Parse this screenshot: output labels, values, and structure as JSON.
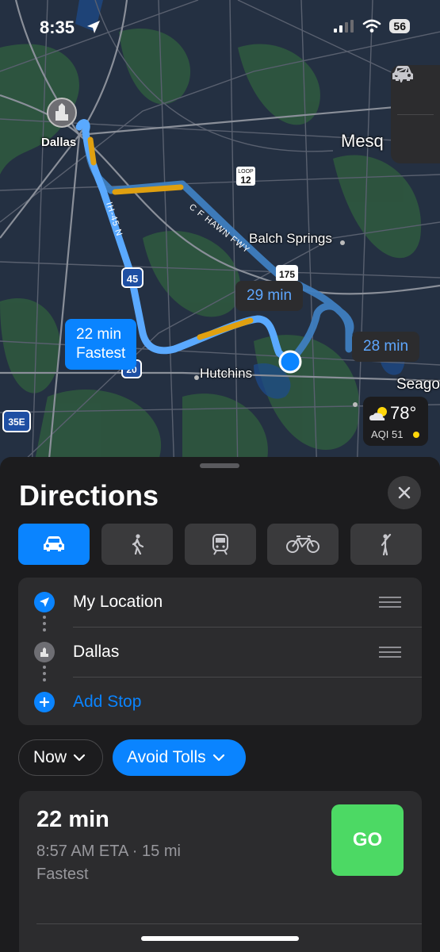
{
  "status_bar": {
    "time": "8:35",
    "battery": "56"
  },
  "map": {
    "labels": {
      "dallas": "Dallas",
      "mesq": "Mesq",
      "balch_springs": "Balch Springs",
      "hutchins": "Hutchins",
      "seago": "Seago",
      "loop_top": "LOOP",
      "loop_num": "12",
      "i45_shield": "45",
      "i20_shield": "20",
      "i35e_shield": "35E",
      "us175_shield": "175",
      "ih45n": "IH-45 N",
      "cfhawn": "C F HAWN FWY"
    },
    "routes": [
      {
        "time": "29 min"
      },
      {
        "time": "28 min"
      },
      {
        "time": "22 min",
        "tag": "Fastest",
        "selected": true
      }
    ],
    "weather": {
      "temp": "78°",
      "aqi": "AQI 51"
    }
  },
  "sheet": {
    "title": "Directions",
    "modes": [
      {
        "name": "drive",
        "icon": "car-icon",
        "active": true
      },
      {
        "name": "walk",
        "icon": "walk-icon"
      },
      {
        "name": "transit",
        "icon": "train-icon"
      },
      {
        "name": "cycle",
        "icon": "bicycle-icon"
      },
      {
        "name": "ride",
        "icon": "person-hail-icon"
      }
    ],
    "stops": {
      "origin": "My Location",
      "destination": "Dallas",
      "add": "Add Stop"
    },
    "options": {
      "time": "Now",
      "avoid": "Avoid Tolls"
    },
    "result": {
      "duration": "22 min",
      "eta": "8:57 AM ETA · 15 mi",
      "tag": "Fastest",
      "go": "GO"
    }
  },
  "colors": {
    "accent": "#0a84ff",
    "go": "#4cd964",
    "route_alt": "#3f7fc0",
    "traffic": "#e0a010"
  }
}
